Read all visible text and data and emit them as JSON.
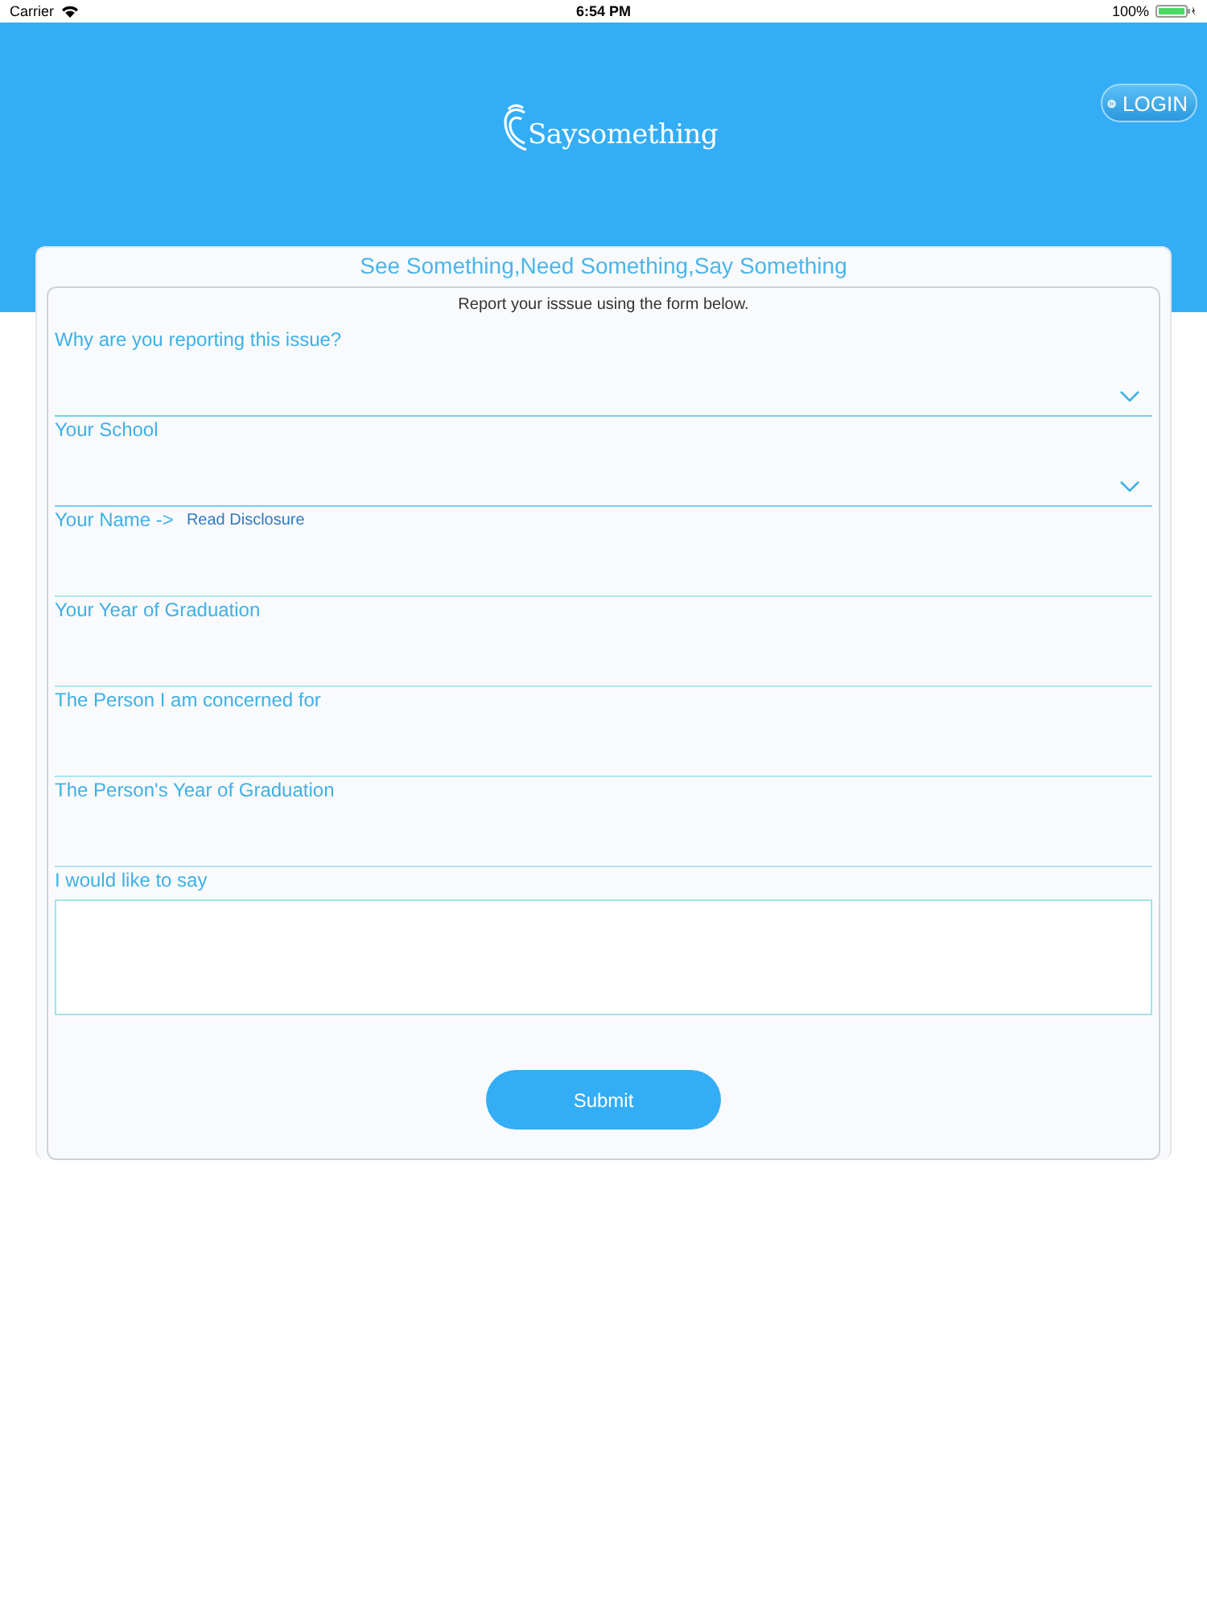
{
  "status_bar": {
    "carrier": "Carrier",
    "time": "6:54 PM",
    "battery": "100%"
  },
  "header": {
    "logo": "Saysomething",
    "login": "LOGIN"
  },
  "form": {
    "title": "See Something,Need Something,Say Something",
    "intro": "Report your isssue using the form below.",
    "fields": [
      {
        "kind": "dropdown",
        "label": "Why are you reporting this issue?"
      },
      {
        "kind": "dropdown",
        "label": "Your School"
      },
      {
        "kind": "text",
        "label": "Your Name ->",
        "link": "Read Disclosure"
      },
      {
        "kind": "text",
        "label": "Your Year of Graduation"
      },
      {
        "kind": "text",
        "label": "The Person I am concerned for"
      },
      {
        "kind": "text",
        "label": "The Person's Year of Graduation"
      },
      {
        "kind": "textarea",
        "label": "I would like to say"
      }
    ],
    "submit": "Submit"
  }
}
